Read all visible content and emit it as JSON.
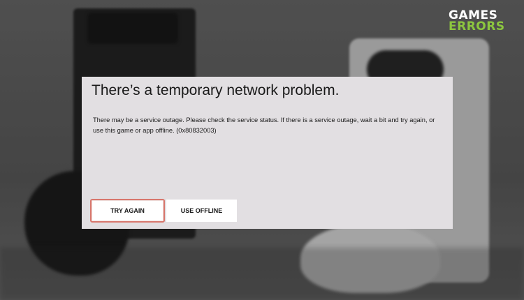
{
  "logo": {
    "line1": "GAMES",
    "line2": "ERRORS",
    "accent_color": "#8cc63f"
  },
  "dialog": {
    "title": "There’s a temporary network problem.",
    "message": "There may be a service outage. Please check the service status. If there is a service outage, wait a bit and try again, or use this game or app offline. (0x80832003)",
    "buttons": {
      "try_again": "TRY AGAIN",
      "use_offline": "USE OFFLINE"
    },
    "focus_color": "#d8776d"
  }
}
